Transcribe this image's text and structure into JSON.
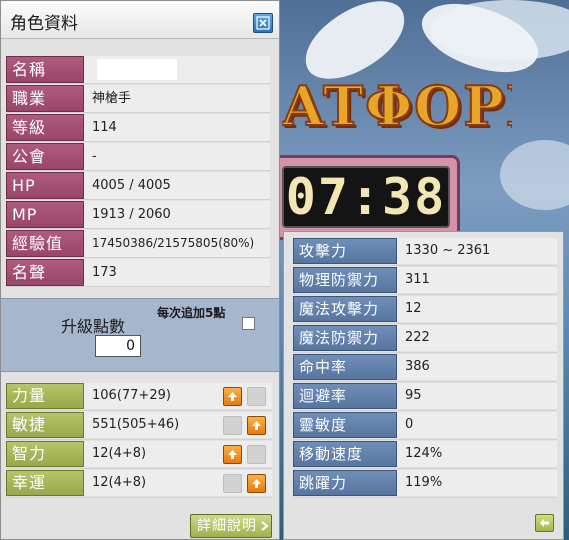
{
  "window": {
    "title": "角色資料"
  },
  "profile": {
    "rows": [
      {
        "label": "名稱",
        "value": ""
      },
      {
        "label": "職業",
        "value": "神槍手"
      },
      {
        "label": "等級",
        "value": "114"
      },
      {
        "label": "公會",
        "value": "-"
      },
      {
        "label": "HP",
        "value": "4005 / 4005"
      },
      {
        "label": "MP",
        "value": "1913 / 2060"
      },
      {
        "label": "經驗值",
        "value": "17450386/21575805(80%)"
      },
      {
        "label": "名聲",
        "value": "173"
      }
    ]
  },
  "level_up": {
    "label": "升級點數",
    "points": "0",
    "auto_label": "每次追加5點"
  },
  "stats": [
    {
      "label": "力量",
      "value": "106(77+29)"
    },
    {
      "label": "敏捷",
      "value": "551(505+46)"
    },
    {
      "label": "智力",
      "value": "12(4+8)"
    },
    {
      "label": "幸運",
      "value": "12(4+8)"
    }
  ],
  "detail_button": "詳細說明",
  "detail_stats": [
    {
      "label": "攻擊力",
      "value": "1330 ~ 2361"
    },
    {
      "label": "物理防禦力",
      "value": "311"
    },
    {
      "label": "魔法攻擊力",
      "value": "12"
    },
    {
      "label": "魔法防禦力",
      "value": "222"
    },
    {
      "label": "命中率",
      "value": "386"
    },
    {
      "label": "迴避率",
      "value": "95"
    },
    {
      "label": "靈敏度",
      "value": "0"
    },
    {
      "label": "移動速度",
      "value": "124%"
    },
    {
      "label": "跳躍力",
      "value": "119%"
    }
  ],
  "background": {
    "banner_text": "ATΦOPM",
    "timer": "07:38"
  },
  "colors": {
    "profile_label": "#a8527a",
    "stat_label": "#aab95c",
    "detail_label": "#6584b0",
    "plus_button": "#f0951f"
  },
  "icons": {
    "close": "close-icon",
    "plus": "up-arrow-icon",
    "collapse": "left-arrow-icon"
  }
}
